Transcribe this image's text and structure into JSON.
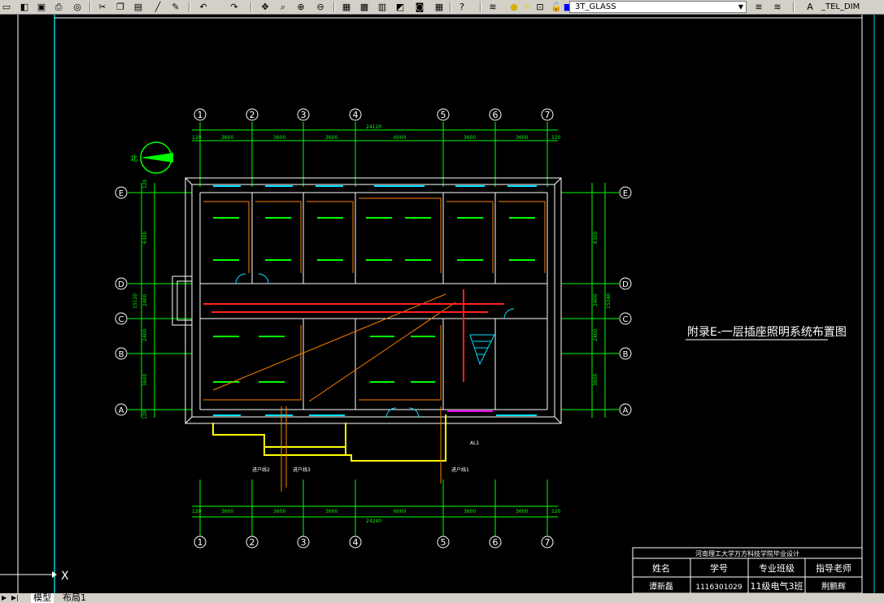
{
  "toolbar": {
    "icons": [
      "new-file-icon",
      "open-icon",
      "save-icon",
      "print-icon",
      "preview-icon",
      "publish-icon",
      "cut-icon",
      "copy-icon",
      "paste-icon",
      "match-prop-icon",
      "brush-icon",
      "undo-icon",
      "redo-icon",
      "pan-icon",
      "zoom-realtime-icon",
      "zoom-window-icon",
      "zoom-previous-icon",
      "properties-icon",
      "design-center-icon",
      "tool-palettes-icon",
      "sheet-set-icon",
      "markup-icon",
      "calculator-icon",
      "help-icon"
    ],
    "layer_current": "3T_GLASS",
    "dim_style": "_TEL_DIM"
  },
  "drawing": {
    "title": "附录E-一层插座照明系统布置图",
    "north_label": "北",
    "axes_numbers": [
      "1",
      "2",
      "3",
      "4",
      "5",
      "6",
      "7"
    ],
    "axes_letters": [
      "E",
      "D",
      "C",
      "B",
      "A"
    ],
    "top_dims": [
      "120",
      "3600",
      "3600",
      "3600",
      "6000",
      "3600",
      "3600",
      "120"
    ],
    "top_total": "24120",
    "bottom_dims": [
      "120",
      "3600",
      "3600",
      "3600",
      "6000",
      "3600",
      "3600",
      "120"
    ],
    "bottom_total": "24240",
    "left_dims": [
      "120",
      "6300",
      "2400",
      "2400",
      "3600",
      "120"
    ],
    "left_total": "15120",
    "right_dims": [
      "6300",
      "2400",
      "2400",
      "3600"
    ],
    "right_total": "15240",
    "panel_label": "AL1",
    "feed_labels": [
      "进户线2",
      "进户线3",
      "进户线1"
    ]
  },
  "title_block": {
    "school": "河南理工大学万方科技学院毕业设计",
    "headers": [
      "姓名",
      "学号",
      "专业班级",
      "指导老师"
    ],
    "values": [
      "谭新磊",
      "1116301029",
      "11级电气3班",
      "荆鹏辉"
    ]
  },
  "ucs": {
    "x_label": "X"
  },
  "tabs": {
    "model": "模型",
    "layout1": "布局1"
  }
}
